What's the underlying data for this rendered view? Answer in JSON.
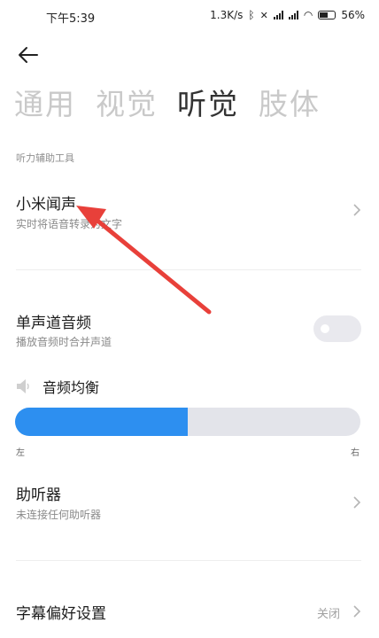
{
  "status": {
    "time": "下午5:39",
    "speed": "1.3K/s",
    "battery": "56%"
  },
  "tabs": [
    {
      "label": "通用",
      "active": false
    },
    {
      "label": "视觉",
      "active": false
    },
    {
      "label": "听觉",
      "active": true
    },
    {
      "label": "肢体",
      "active": false
    }
  ],
  "section": {
    "header": "听力辅助工具"
  },
  "items": {
    "xiaomi_wensheng": {
      "title": "小米闻声",
      "subtitle": "实时将语音转录为文字"
    },
    "mono_audio": {
      "title": "单声道音频",
      "subtitle": "播放音频时合并声道",
      "enabled": false
    },
    "balance": {
      "title": "音频均衡",
      "left_label": "左",
      "right_label": "右",
      "level": 0.5
    },
    "hearing_aid": {
      "title": "助听器",
      "subtitle": "未连接任何助听器"
    },
    "caption": {
      "title": "字幕偏好设置",
      "value": "关闭"
    }
  },
  "colors": {
    "accent": "#2d8ff0",
    "annotation_arrow": "#e8403a"
  }
}
